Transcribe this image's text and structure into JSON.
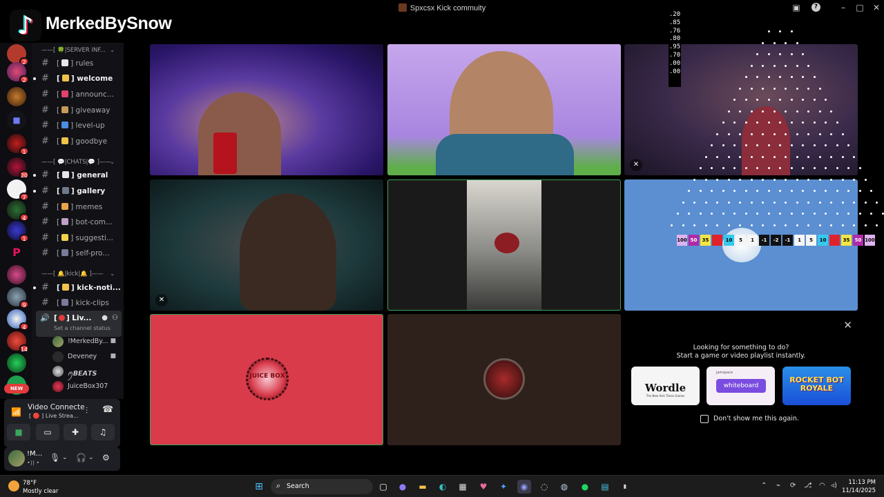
{
  "window": {
    "title": "Spxcsx Kick commuity"
  },
  "overlay": {
    "tiktok_name": "MerkedBySnow",
    "side_numbers": [
      ".20",
      ".85",
      ".76",
      ".80",
      ".95",
      ".70",
      ".00",
      ".00"
    ]
  },
  "rail": {
    "badges": [
      "2",
      "2",
      "1",
      "20",
      "7",
      "4",
      "1",
      "9",
      "4",
      "14"
    ],
    "new_label": "NEW"
  },
  "channels": {
    "categories": {
      "server_info": "——[ 🍀|SERVER INF...",
      "chats": "——[ 💬|CHATS|💬 ]——",
      "kick": "——[ 🔔|kick|🔔 ]——"
    },
    "items": [
      {
        "label": "rules",
        "bold": false
      },
      {
        "label": "welcome",
        "bold": true
      },
      {
        "label": "announc...",
        "bold": false
      },
      {
        "label": "giveaway",
        "bold": false
      },
      {
        "label": "level-up",
        "bold": false
      },
      {
        "label": "goodbye",
        "bold": false
      },
      {
        "label": "general",
        "bold": true
      },
      {
        "label": "gallery",
        "bold": true
      },
      {
        "label": "memes",
        "bold": false
      },
      {
        "label": "bot-com...",
        "bold": false
      },
      {
        "label": "suggesti...",
        "bold": false
      },
      {
        "label": "self-pro...",
        "bold": false
      },
      {
        "label": "kick-noti...",
        "bold": true
      },
      {
        "label": "kick-clips",
        "bold": false
      }
    ],
    "voice_channel": {
      "name": "Liv...",
      "status": "Set a channel status"
    },
    "voice_users": [
      {
        "name": "!MerkedBy..."
      },
      {
        "name": "Deveney"
      },
      {
        "name": "ꪑ𝘽𝙀𝘼𝙏𝙎"
      },
      {
        "name": "JuiceBox307"
      }
    ]
  },
  "voice_panel": {
    "status": "Video Connecte",
    "channel": "[ 🔴 ] Live Strea..."
  },
  "user_panel": {
    "name": "!M...",
    "status": "•)) •"
  },
  "tiles": {
    "juice_label": "JUICE BOX",
    "game_strip": [
      "100",
      "50",
      "35",
      "",
      "10",
      "5",
      "1",
      "-1",
      "-2",
      "-1",
      "1",
      "5",
      "10",
      "",
      "35",
      "50",
      "100"
    ]
  },
  "activity": {
    "heading": "Looking for something to do?",
    "sub": "Start a game or video playlist instantly.",
    "cards": [
      {
        "title": "Wordle",
        "subtitle": "The New York Times Games"
      },
      {
        "title": "whiteboard",
        "subtitle": "Jamspace"
      },
      {
        "title": "ROCKET BOT ROYALE",
        "subtitle": ""
      }
    ],
    "dont_show": "Don't show me this again."
  },
  "taskbar": {
    "temp": "78°F",
    "condition": "Mostly clear",
    "search": "Search",
    "time": "11:13 PM",
    "date": "11/14/2025"
  },
  "colors": {
    "accent_green": "#3ba55d",
    "juice_tile": "#d93b4b",
    "activity_bg": "#000000"
  }
}
